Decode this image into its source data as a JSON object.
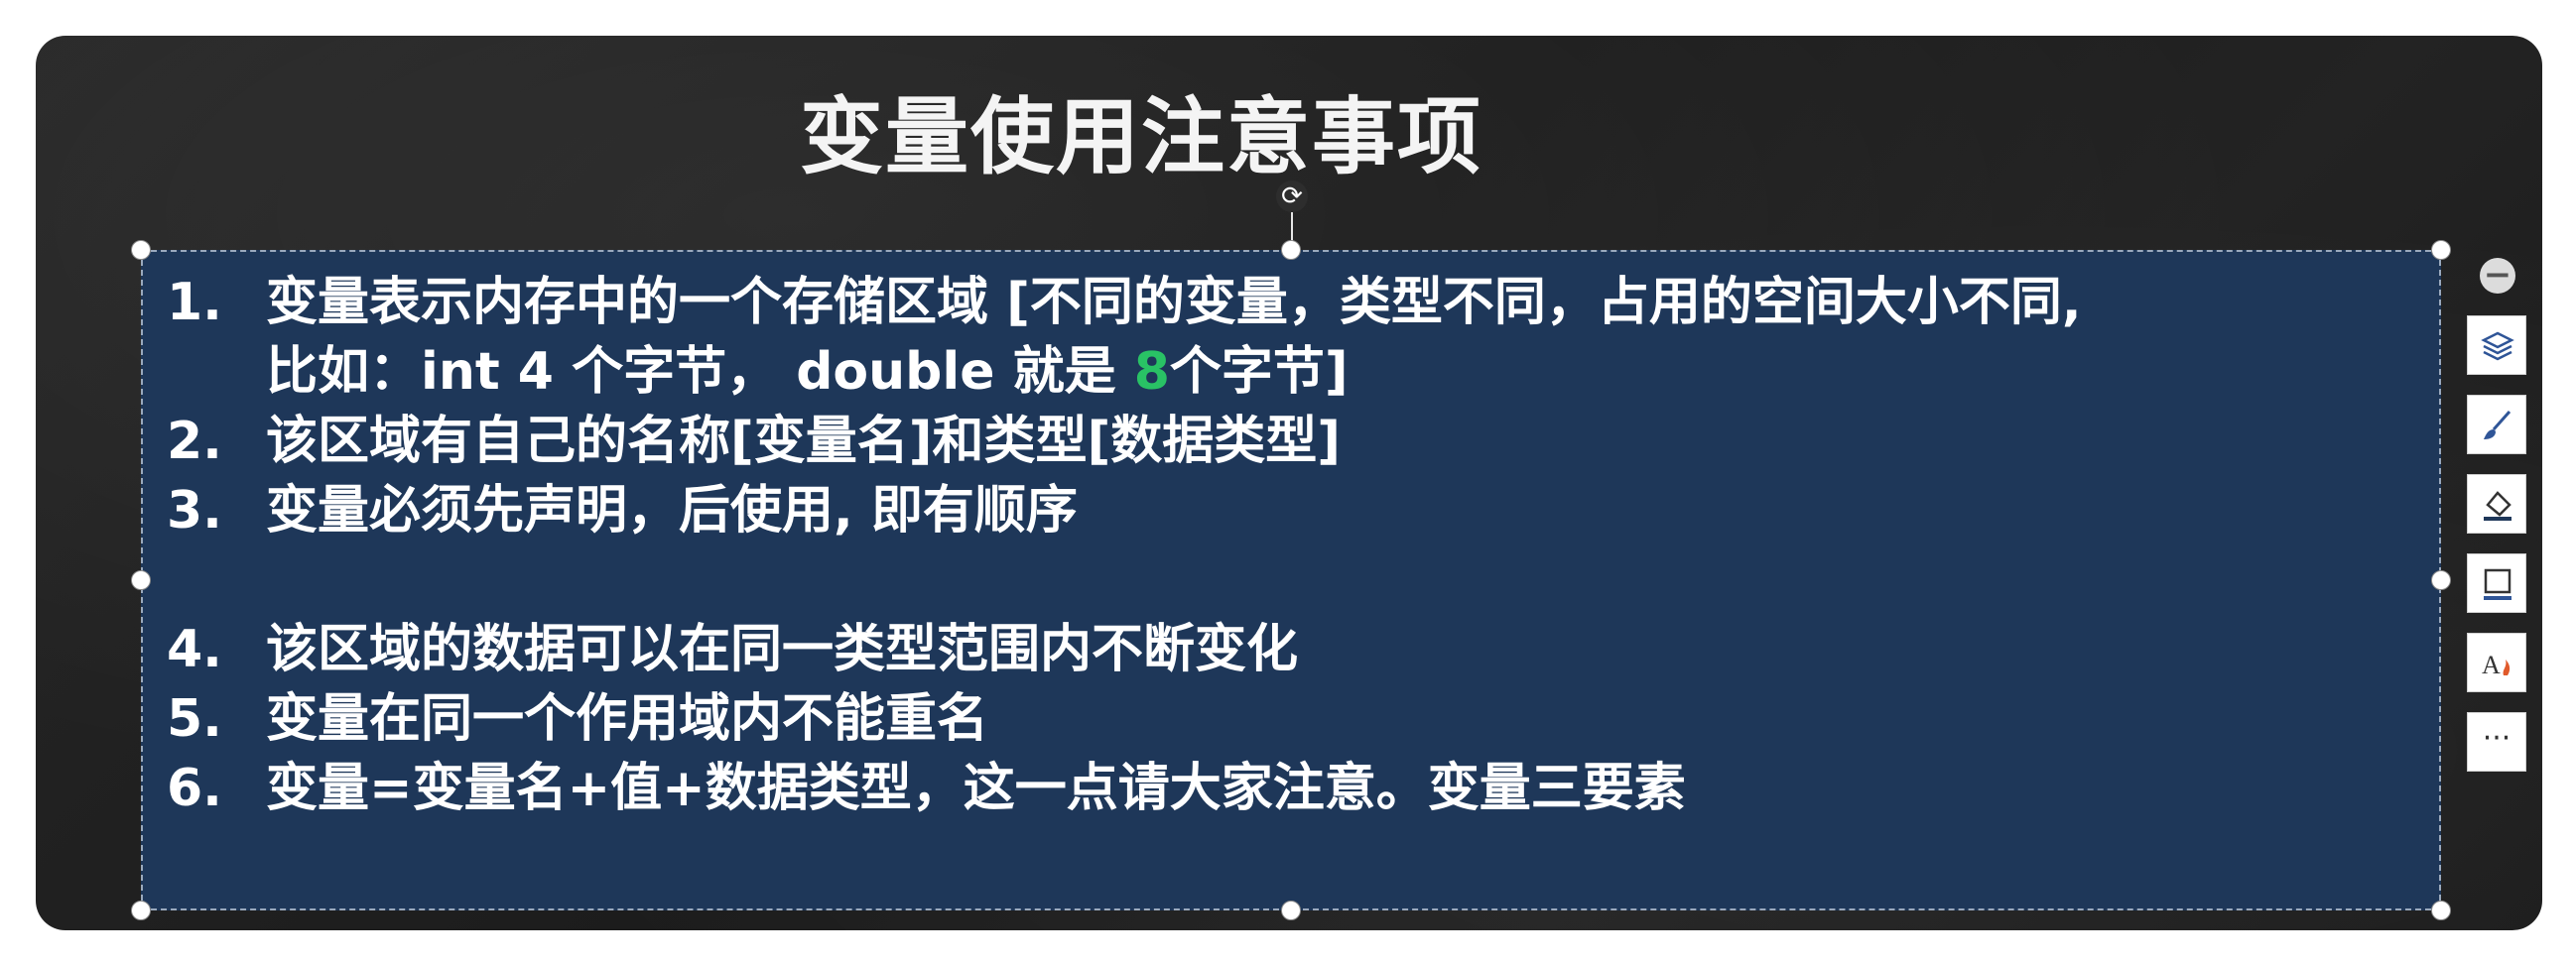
{
  "slide": {
    "title": "变量使用注意事项",
    "items": [
      {
        "num": "1.",
        "line1": "变量表示内存中的一个存储区域 [不同的变量，类型不同，占用的空间大小不同,",
        "line2_before": "比如：int 4 个字节， double 就是 ",
        "line2_highlight": "8",
        "line2_after": "个字节]"
      },
      {
        "num": "2.",
        "text": "该区域有自己的名称[变量名]和类型[数据类型]"
      },
      {
        "num": "3.",
        "text": "变量必须先声明，后使用, 即有顺序"
      },
      {
        "num": "4.",
        "text": "该区域的数据可以在同一类型范围内不断变化"
      },
      {
        "num": "5.",
        "text": "变量在同一个作用域内不能重名"
      },
      {
        "num": "6.",
        "text": "变量=变量名+值+数据类型，这一点请大家注意。变量三要素"
      }
    ]
  },
  "toolbar": {
    "buttons": [
      "collapse-icon",
      "layers-icon",
      "brush-icon",
      "fill-icon",
      "border-icon",
      "text-effect-icon",
      "more-icon"
    ],
    "more_label": "···"
  },
  "colors": {
    "board": "#222222",
    "textbox_fill": "#1e3759",
    "highlight": "#29c265"
  }
}
